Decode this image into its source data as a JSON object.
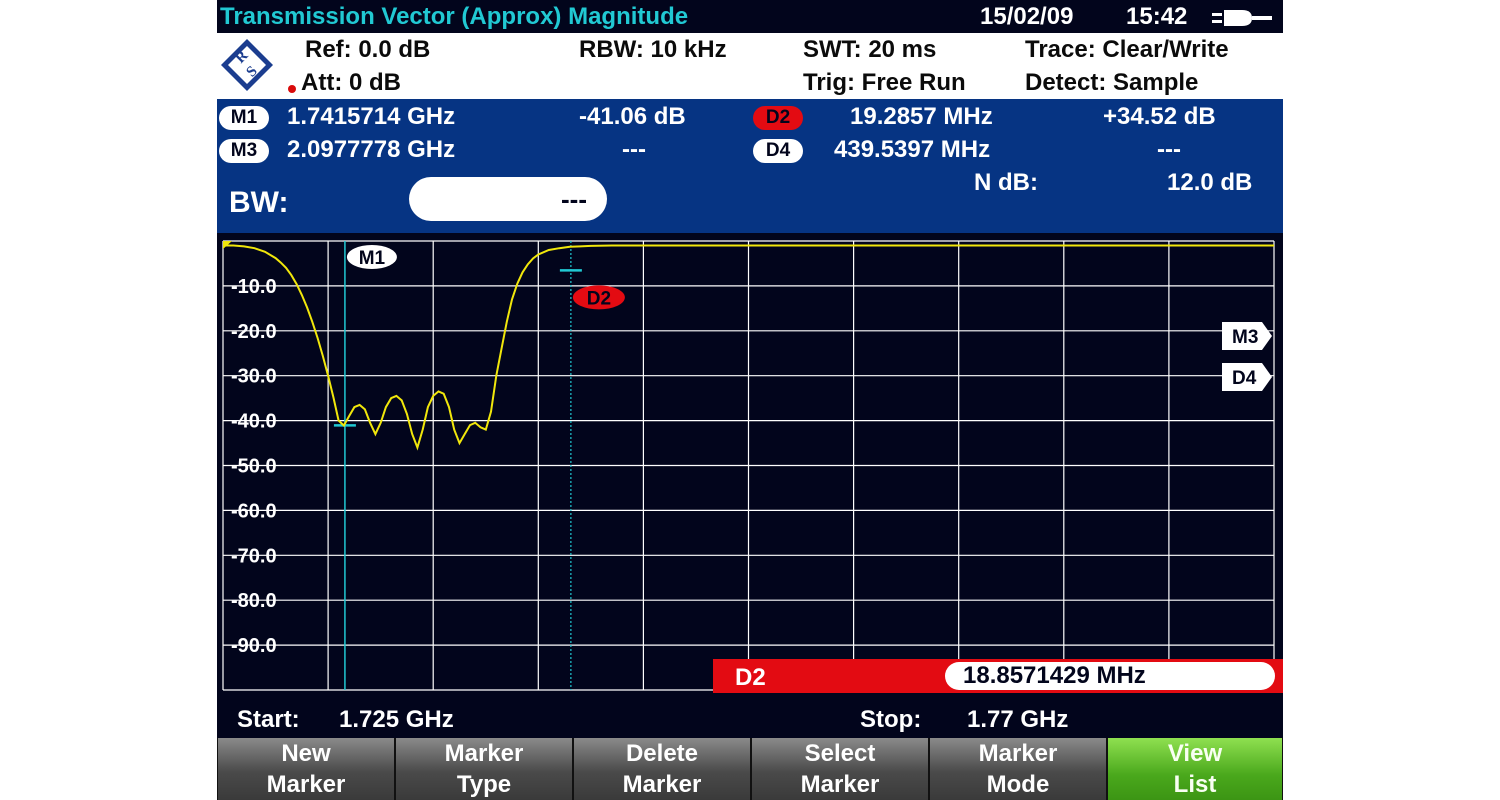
{
  "title": "Transmission Vector (Approx) Magnitude",
  "date": "15/02/09",
  "time": "15:42",
  "colors": {
    "background": "#02051c",
    "title": "#21c9d3",
    "panel": "#063483",
    "trace": "#f1e70b",
    "marker_line": "#21c9d3",
    "delta": "#e30b12",
    "softkey_active": "#4aa81c"
  },
  "settings": {
    "ref": "Ref: 0.0 dB",
    "att": "Att: 0 dB",
    "rbw": "RBW: 10 kHz",
    "swt": "SWT: 20 ms",
    "trig": "Trig: Free Run",
    "trace": "Trace: Clear/Write",
    "detect": "Detect: Sample"
  },
  "markers": [
    {
      "badge": "M1",
      "freq": "1.7415714 GHz",
      "level": "-41.06 dB",
      "style": "white"
    },
    {
      "badge": "D2",
      "freq": "19.2857 MHz",
      "level": "+34.52 dB",
      "style": "red"
    },
    {
      "badge": "M3",
      "freq": "2.0977778 GHz",
      "level": "---",
      "style": "white"
    },
    {
      "badge": "D4",
      "freq": "439.5397 MHz",
      "level": "---",
      "style": "white"
    }
  ],
  "bw": {
    "label": "BW:",
    "value": "---",
    "ndb_label": "N dB:",
    "ndb_value": "12.0 dB"
  },
  "chart_data": {
    "type": "line",
    "ylim": [
      -100,
      0
    ],
    "y_ticks": [
      "-10.0",
      "-20.0",
      "-30.0",
      "-40.0",
      "-50.0",
      "-60.0",
      "-70.0",
      "-80.0",
      "-90.0"
    ],
    "x_start": "1.725 GHz",
    "x_stop": "1.77 GHz",
    "grid": true,
    "x": [
      0,
      0.1,
      0.2,
      0.3,
      0.4,
      0.5,
      0.55,
      0.6,
      0.65,
      0.7,
      0.75,
      0.8,
      0.85,
      0.9,
      0.95,
      1.0,
      1.05,
      1.1,
      1.15,
      1.2,
      1.25,
      1.3,
      1.35,
      1.4,
      1.45,
      1.5,
      1.55,
      1.6,
      1.65,
      1.7,
      1.75,
      1.8,
      1.85,
      1.9,
      1.95,
      2.0,
      2.05,
      2.1,
      2.15,
      2.2,
      2.25,
      2.3,
      2.35,
      2.4,
      2.45,
      2.5,
      2.55,
      2.6,
      2.65,
      2.7,
      2.75,
      2.8,
      2.85,
      2.9,
      2.95,
      3.0,
      3.1,
      3.2,
      3.3,
      3.4,
      3.5,
      3.7,
      4.0,
      4.5,
      5.0,
      5.5,
      6.0,
      6.5,
      7.0,
      7.5,
      8.0,
      8.5,
      9.0,
      9.5,
      10.0
    ],
    "y": [
      -1.0,
      -1.0,
      -1.2,
      -1.6,
      -2.4,
      -3.8,
      -4.8,
      -6.0,
      -7.6,
      -9.6,
      -12.0,
      -14.8,
      -18.0,
      -21.6,
      -25.6,
      -30.0,
      -34.8,
      -40.0,
      -41.1,
      -39.0,
      -37.0,
      -36.5,
      -37.5,
      -40.5,
      -43.0,
      -40.5,
      -37.0,
      -35.0,
      -34.5,
      -35.5,
      -38.5,
      -43.0,
      -46.0,
      -42.0,
      -37.0,
      -34.5,
      -33.5,
      -34.0,
      -37.0,
      -42.0,
      -45.0,
      -43.0,
      -41.0,
      -40.5,
      -41.5,
      -42.0,
      -38.0,
      -30.0,
      -24.0,
      -18.0,
      -13.0,
      -9.5,
      -7.0,
      -5.2,
      -3.9,
      -3.0,
      -2.0,
      -1.6,
      -1.3,
      -1.2,
      -1.1,
      -1.0,
      -1.0,
      -1.0,
      -1.0,
      -1.0,
      -1.0,
      -1.0,
      -1.0,
      -1.0,
      -1.0,
      -1.0,
      -1.0,
      -1.0,
      -1.0
    ],
    "marker_labels": {
      "m1": "M1",
      "d2": "D2",
      "m3": "M3",
      "d4": "D4"
    },
    "m1": {
      "x": 1.16,
      "y": -41.06
    },
    "d2": {
      "x": 3.31,
      "y": -6.54
    }
  },
  "active_marker": {
    "label": "D2",
    "value": "18.8571429 MHz"
  },
  "freq": {
    "start_label": "Start:",
    "start_value": "1.725 GHz",
    "stop_label": "Stop:",
    "stop_value": "1.77 GHz"
  },
  "softkeys": [
    {
      "line1": "New",
      "line2": "Marker"
    },
    {
      "line1": "Marker",
      "line2": "Type"
    },
    {
      "line1": "Delete",
      "line2": "Marker"
    },
    {
      "line1": "Select",
      "line2": "Marker"
    },
    {
      "line1": "Marker",
      "line2": "Mode"
    },
    {
      "line1": "View",
      "line2": "List"
    }
  ]
}
